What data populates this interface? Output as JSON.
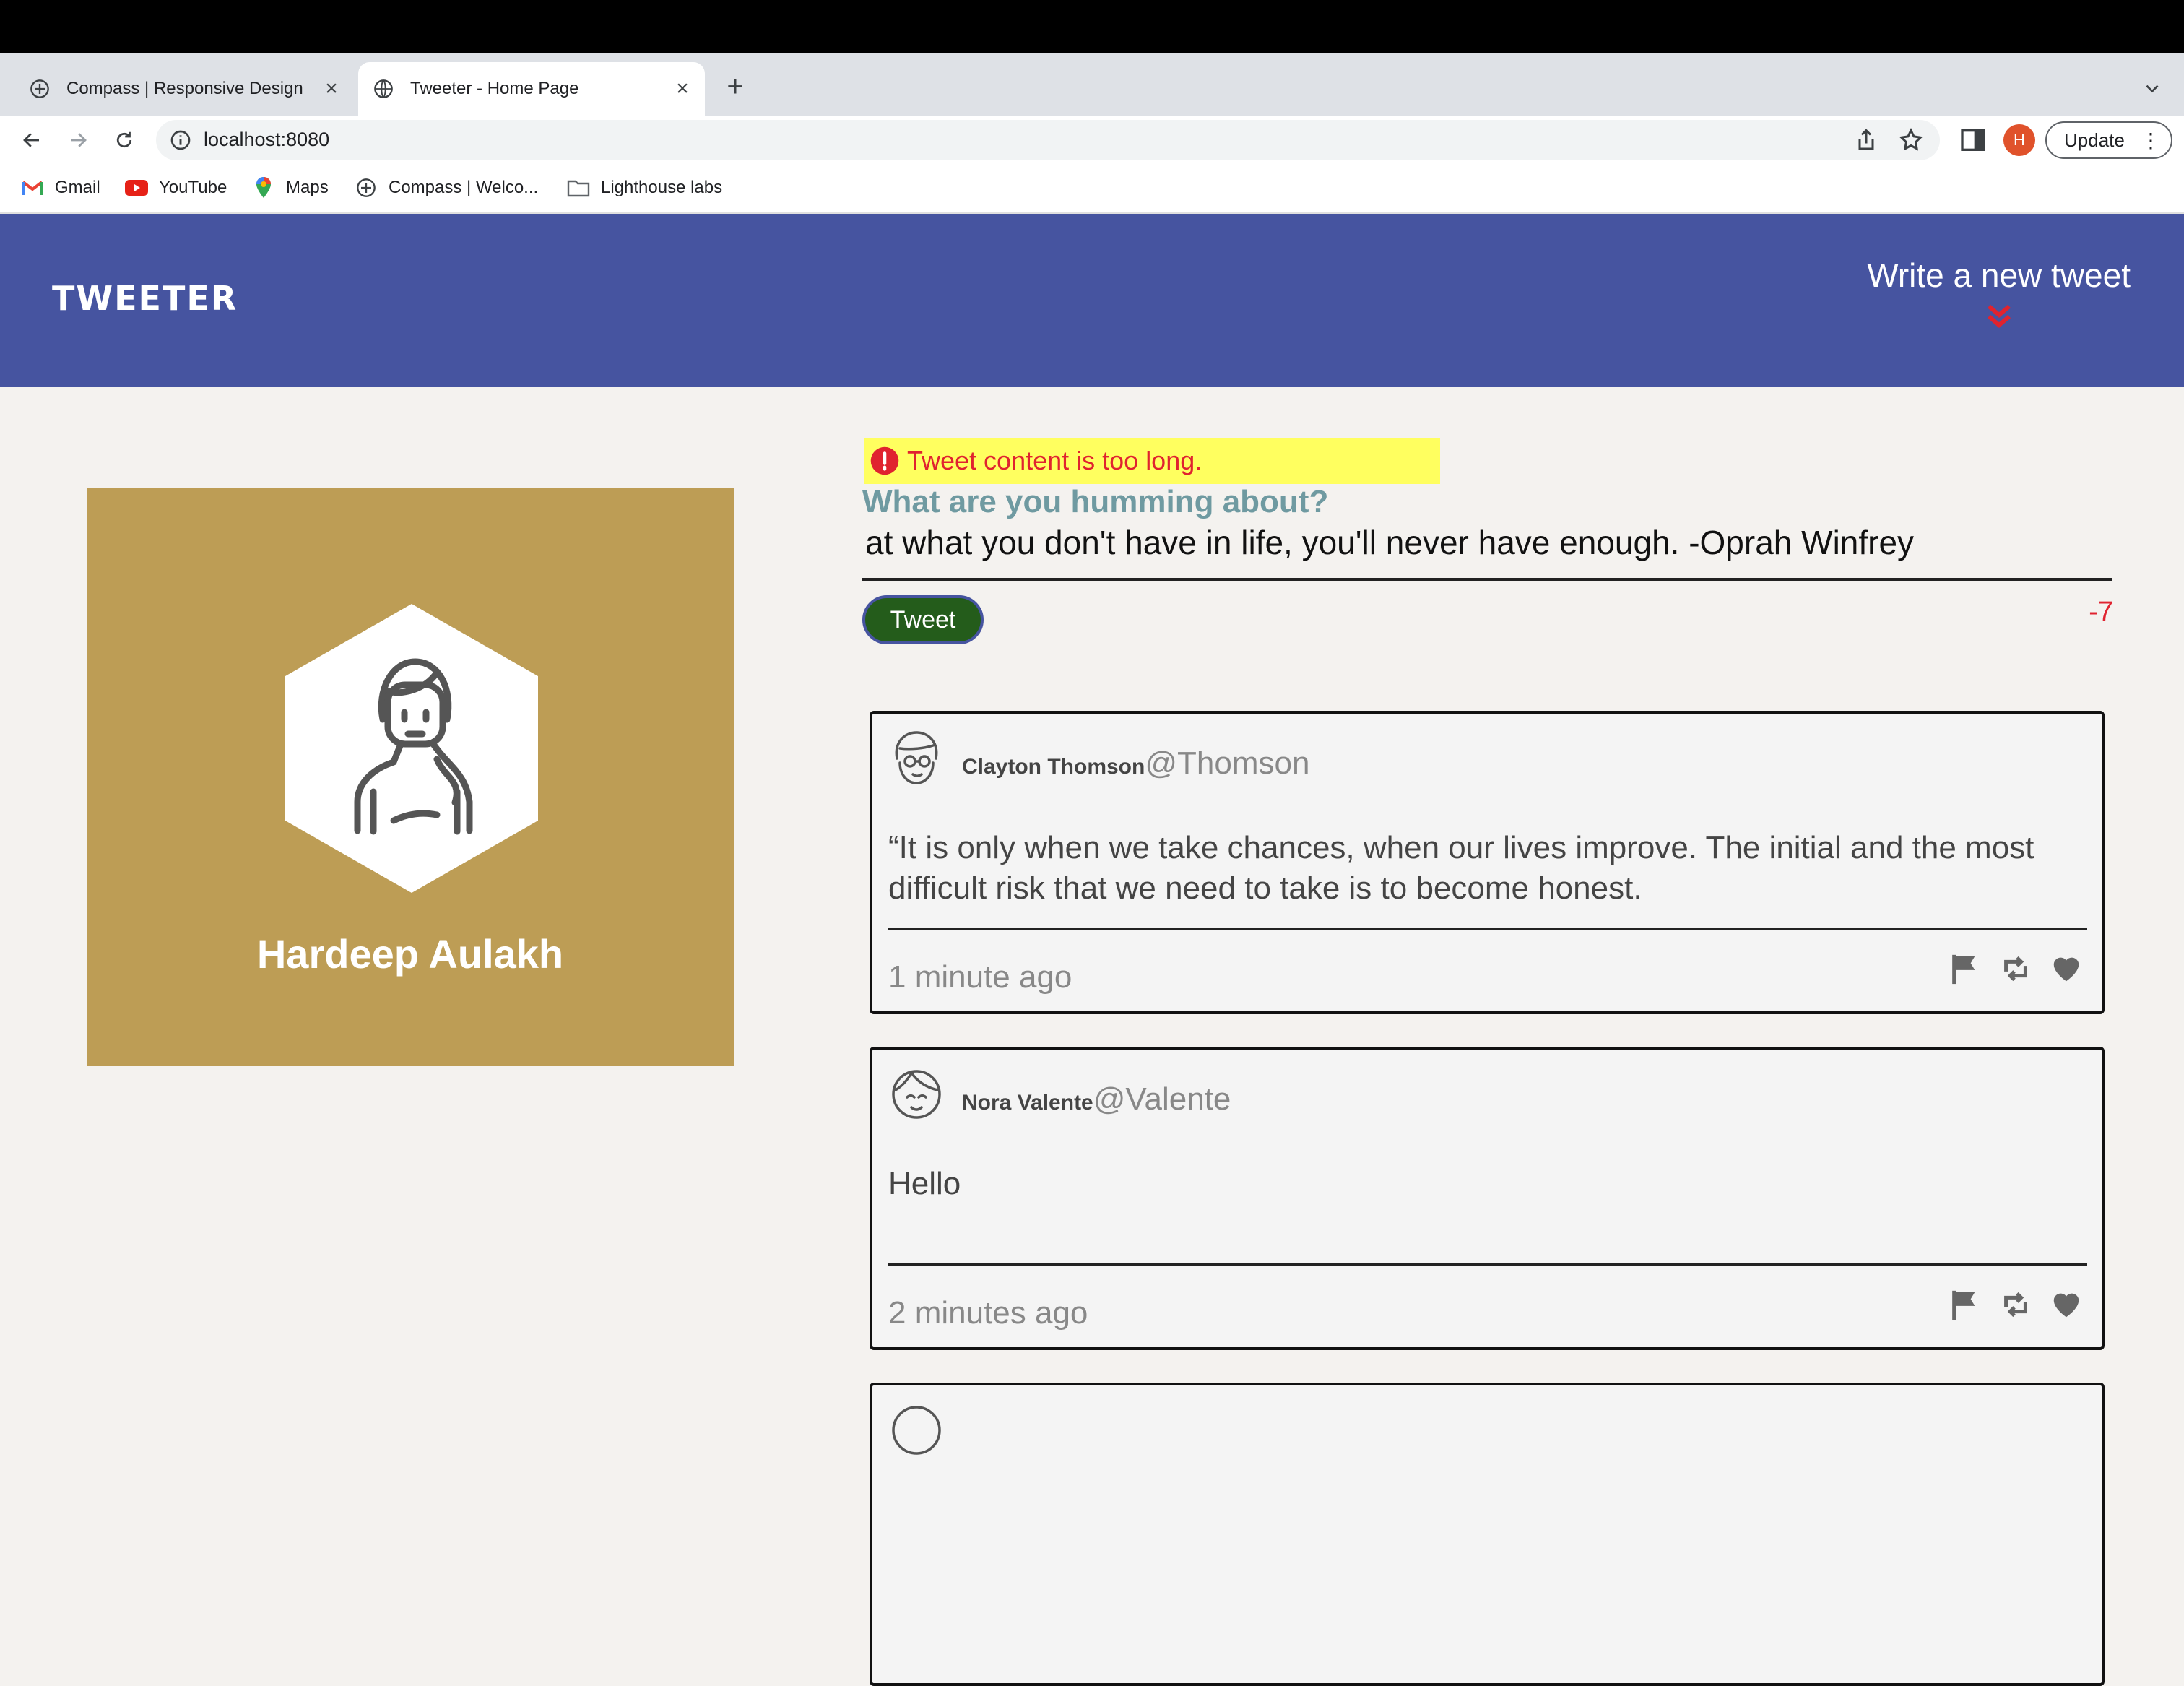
{
  "browser": {
    "tabs": [
      {
        "title": "Compass | Responsive Design",
        "active": false,
        "icon": "compass-icon"
      },
      {
        "title": "Tweeter - Home Page",
        "active": true,
        "icon": "globe-icon"
      }
    ],
    "url": "localhost:8080",
    "profile_initial": "H",
    "update_label": "Update",
    "bookmarks": [
      {
        "label": "Gmail",
        "icon": "gmail-icon"
      },
      {
        "label": "YouTube",
        "icon": "youtube-icon"
      },
      {
        "label": "Maps",
        "icon": "maps-icon"
      },
      {
        "label": "Compass | Welco...",
        "icon": "compass-icon"
      },
      {
        "label": "Lighthouse labs",
        "icon": "folder-icon"
      }
    ]
  },
  "nav": {
    "brand": "TWEETER",
    "write_new": "Write a new tweet"
  },
  "profile": {
    "name": "Hardeep Aulakh"
  },
  "compose": {
    "error": "Tweet content is too long.",
    "label": "What are you humming about?",
    "text": "at what you don't have in life, you'll never have enough. -Oprah Winfrey",
    "button": "Tweet",
    "counter": "-7"
  },
  "tweets": [
    {
      "name": "Clayton Thomson",
      "handle": "@Thomson",
      "text": "“It is only when we take chances, when our lives improve. The initial and the most difficult risk that we need to take is to become honest.",
      "time": "1 minute ago"
    },
    {
      "name": "Nora Valente",
      "handle": "@Valente",
      "text": "Hello",
      "time": "2 minutes ago"
    }
  ],
  "colors": {
    "nav_bg": "#4654a0",
    "page_bg": "#f4f2ef",
    "profile_bg": "#bd9d55",
    "error_bg": "#ffff5f",
    "error_text": "#e0232f",
    "tweet_button": "#245c1b",
    "label": "#6f9aa1"
  }
}
